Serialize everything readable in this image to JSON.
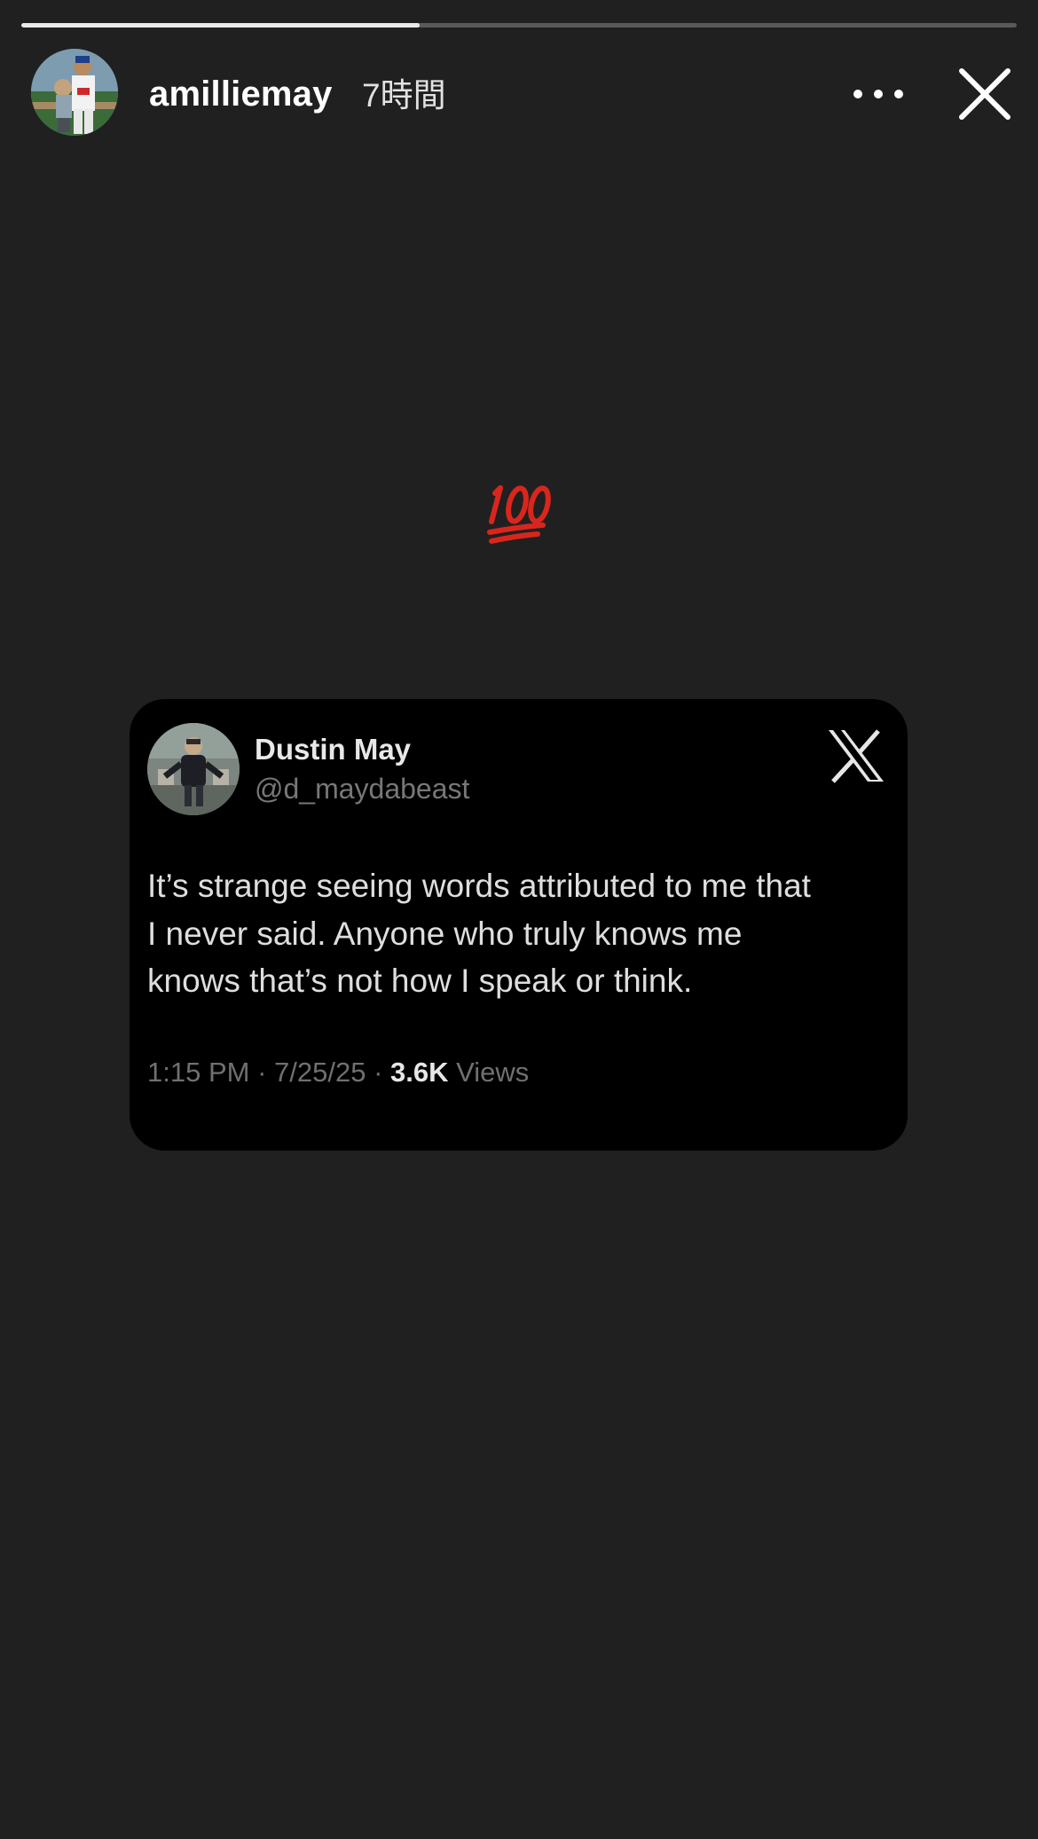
{
  "story": {
    "progress": 0.4,
    "username": "amilliemay",
    "time_ago": "7時間"
  },
  "icons": {
    "more": "more-horizontal-icon",
    "close": "close-icon",
    "emoji": "hundred-points-emoji-icon",
    "x_logo": "x-logo-icon"
  },
  "tweet": {
    "display_name": "Dustin May",
    "handle": "@d_maydabeast",
    "lines": [
      "It’s strange seeing words attributed to me that",
      "I never said. Anyone who truly knows me",
      "knows that’s not how I speak or think."
    ],
    "time": "1:15 PM",
    "date": "7/25/25",
    "separator": "·",
    "views_count": "3.6K",
    "views_label": "Views"
  },
  "colors": {
    "background": "#202020",
    "card": "#000000",
    "emoji_red": "#d9261c"
  }
}
